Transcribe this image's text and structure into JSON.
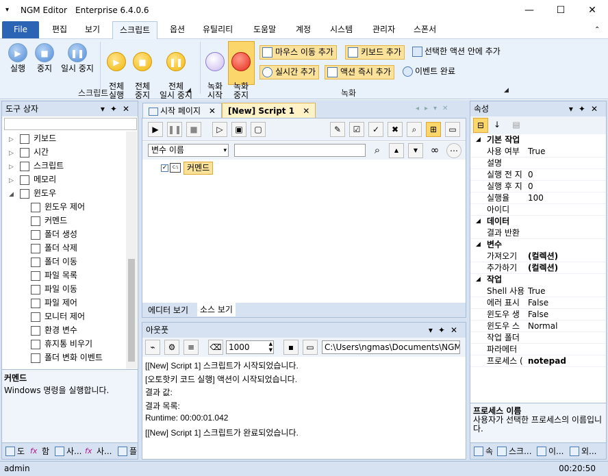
{
  "window": {
    "app_name": "NGM Editor",
    "edition": "Enterprise 6.4.0.6",
    "minimize": "—",
    "maximize": "☐",
    "close": "✕"
  },
  "menu": {
    "items": [
      "File",
      "편집",
      "보기",
      "스크립트",
      "옵션",
      "유틸리티",
      "도움말",
      "계정",
      "시스템",
      "관리자",
      "스폰서"
    ],
    "active": "스크립트"
  },
  "ribbon": {
    "script_group": {
      "label": "스크립트",
      "run": "실행",
      "stop": "중지",
      "pause": "일시 중지",
      "run_all": "전체\n실행",
      "stop_all": "전체\n중지",
      "pause_all": "전체\n일시 중지"
    },
    "record_group": {
      "label": "녹화",
      "record_start": "녹화\n시작",
      "record_stop": "녹화\n중지",
      "add_mouse_move": "마우스 이동 추가",
      "add_keyboard": "키보드 추가",
      "add_in_selected_action": "선택한 액션 안에 추가",
      "add_realtime": "실시간 추가",
      "add_action_immediate": "액션 즉시 추가",
      "event_done": "이벤트 완료"
    }
  },
  "toolbox": {
    "title": "도구 상자",
    "items": [
      {
        "label": "키보드",
        "level": 0,
        "expander": "▷"
      },
      {
        "label": "시간",
        "level": 0,
        "expander": "▷"
      },
      {
        "label": "스크립트",
        "level": 0,
        "expander": "▷"
      },
      {
        "label": "메모리",
        "level": 0,
        "expander": "▷"
      },
      {
        "label": "윈도우",
        "level": 0,
        "expander": "◢"
      },
      {
        "label": "윈도우 제어",
        "level": 1
      },
      {
        "label": "커멘드",
        "level": 1
      },
      {
        "label": "폴더 생성",
        "level": 1
      },
      {
        "label": "폴더 삭제",
        "level": 1
      },
      {
        "label": "폴더 이동",
        "level": 1
      },
      {
        "label": "파일 목록",
        "level": 1
      },
      {
        "label": "파일 이동",
        "level": 1
      },
      {
        "label": "파일 제어",
        "level": 1
      },
      {
        "label": "모니터 제어",
        "level": 1
      },
      {
        "label": "환경 변수",
        "level": 1
      },
      {
        "label": "휴지통 비우기",
        "level": 1
      },
      {
        "label": "폴더 변화 이벤트",
        "level": 1
      }
    ],
    "desc_title": "커멘드",
    "desc_text": "Windows 명령을 실행합니다.",
    "bottom_tabs": [
      "도",
      "함",
      "사...",
      "사...",
      "플"
    ]
  },
  "editor": {
    "tabs": [
      {
        "label": "시작 페이지",
        "close": "✕"
      },
      {
        "label": "[New] Script 1",
        "close": "✕"
      }
    ],
    "var_select": "변수 이름",
    "node_label": "커멘드",
    "view_tabs": [
      "에디터 보기",
      "소스 보기"
    ]
  },
  "output": {
    "title": "아웃풋",
    "count": "1000",
    "path": "C:\\Users\\ngmas\\Documents\\NGM6\\",
    "lines": [
      "[[New] Script 1] 스크립트가 시작되었습니다.",
      "[오토핫키 코드 실행] 액션이 시작되었습니다.",
      "결과 값:",
      "결과 목록:",
      "Runtime: 00:00:01.042",
      "[[New] Script 1] 스크립트가 완료되었습니다."
    ]
  },
  "properties": {
    "title": "속성",
    "sections": [
      {
        "name": "기본 작업",
        "rows": [
          [
            "사용 여부",
            "True"
          ],
          [
            "설명",
            ""
          ],
          [
            "실행 전 지",
            "0"
          ],
          [
            "실행 후 지",
            "0"
          ],
          [
            "실행율",
            "100"
          ],
          [
            "아이디",
            ""
          ]
        ]
      },
      {
        "name": "데이터",
        "rows": [
          [
            "결과 반환",
            ""
          ]
        ]
      },
      {
        "name": "변수",
        "rows": [
          [
            "가져오기",
            "(컬렉션)"
          ],
          [
            "추가하기",
            "(컬렉션)"
          ]
        ]
      },
      {
        "name": "작업",
        "rows": [
          [
            "Shell 사용",
            "True"
          ],
          [
            "에러 표시",
            "False"
          ],
          [
            "윈도우 생",
            "False"
          ],
          [
            "윈도우 스",
            "Normal"
          ],
          [
            "작업 폴더",
            ""
          ],
          [
            "파라메터",
            ""
          ],
          [
            "프로세스 (",
            "notepad"
          ]
        ]
      }
    ],
    "desc_title": "프로세스 이름",
    "desc_text": "사용자가 선택한 프로세스의 이름입니다.",
    "bottom_tabs": [
      "속",
      "스크...",
      "이...",
      "외..."
    ]
  },
  "status": {
    "user": "admin",
    "time": "00:20:50"
  }
}
